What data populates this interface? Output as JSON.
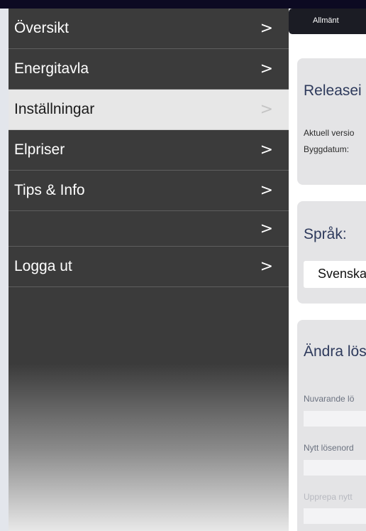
{
  "menu": {
    "items": [
      {
        "label": "Översikt"
      },
      {
        "label": "Energitavla"
      },
      {
        "label": "Inställningar"
      },
      {
        "label": "Elpriser"
      },
      {
        "label": "Tips & Info"
      },
      {
        "label": ""
      },
      {
        "label": "Logga ut"
      }
    ],
    "active_item": "Inställningar",
    "chevron": ">"
  },
  "settings": {
    "tab_label": "Allmänt",
    "release": {
      "title": "Releasei",
      "current_version_label": "Aktuell versio",
      "build_date_label": "Byggdatum:"
    },
    "language": {
      "title": "Språk:",
      "selected": "Svenska"
    },
    "password": {
      "title": "Ändra lös",
      "current_label": "Nuvarande lö",
      "new_label": "Nytt lösenord",
      "repeat_label": "Upprepa nytt"
    }
  },
  "colors": {
    "top_bar": "#0c0a22",
    "menu_bg": "#3b3b3b",
    "menu_active_bg": "#e7e7e7",
    "tab_bar": "#1b1c24",
    "card_bg": "#e4e4e6",
    "card_title": "#2e3a5c"
  }
}
